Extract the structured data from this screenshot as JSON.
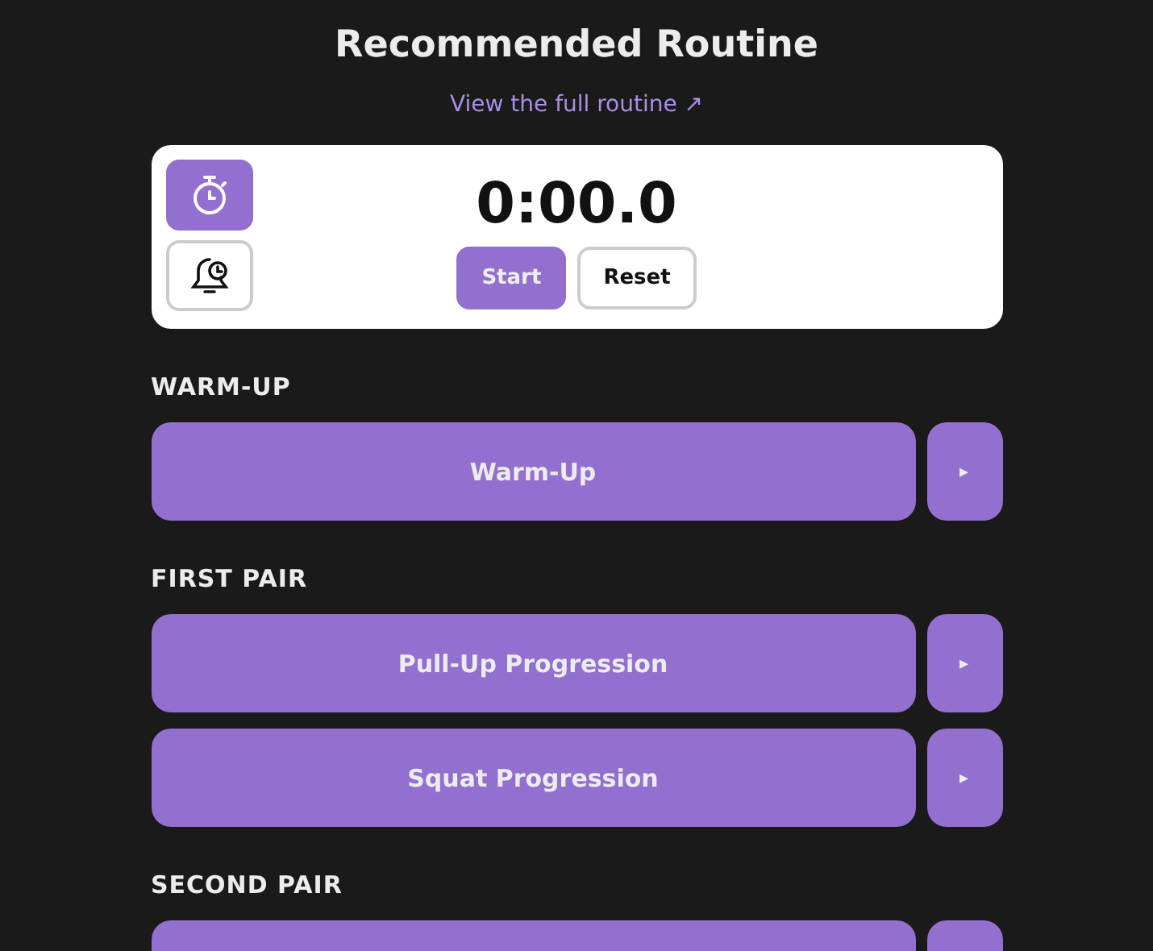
{
  "title": "Recommended Routine",
  "link": "View the full routine ↗",
  "timer": {
    "modes": [
      {
        "kind": "stopwatch",
        "selected": true
      },
      {
        "kind": "alarm",
        "selected": false
      }
    ],
    "time": "0:00.0",
    "buttons": [
      {
        "label": "Start",
        "kind": "primary"
      },
      {
        "label": "Reset",
        "kind": "secondary"
      }
    ]
  },
  "sections": [
    {
      "heading": "WARM-UP",
      "exercises": [
        {
          "kind": "full",
          "label": "Warm-Up",
          "play": "▸"
        }
      ]
    },
    {
      "heading": "FIRST PAIR",
      "exercises": [
        {
          "kind": "full",
          "label": "Pull-Up Progression",
          "play": "▸"
        },
        {
          "kind": "full",
          "label": "Squat Progression",
          "play": "▸"
        }
      ]
    },
    {
      "heading": "SECOND PAIR",
      "exercises": [
        {
          "kind": "cut"
        }
      ]
    }
  ]
}
